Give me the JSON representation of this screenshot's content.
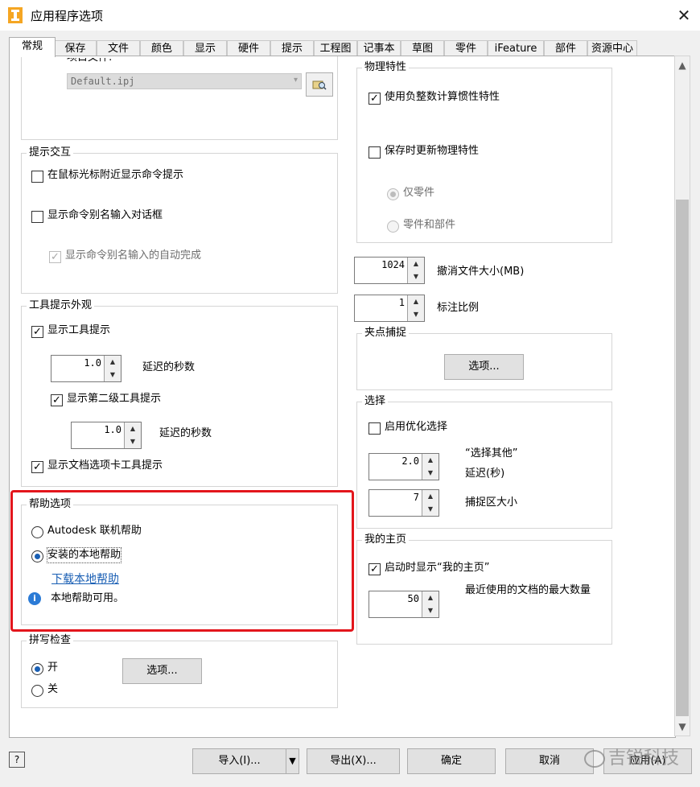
{
  "window": {
    "title": "应用程序选项",
    "close": "✕"
  },
  "tabs": [
    "常规",
    "保存",
    "文件",
    "颜色",
    "显示",
    "硬件",
    "提示",
    "工程图",
    "记事本",
    "草图",
    "零件",
    "iFeature",
    "部件",
    "资源中心"
  ],
  "project": {
    "value": "Default.ipj",
    "partial_label": "项目文件:"
  },
  "prompt_group": {
    "title": "提示交互",
    "show_cmd_near_cursor": "在鼠标光标附近显示命令提示",
    "show_alias_dialog": "显示命令别名输入对话框",
    "alias_autocomplete": "显示命令别名输入的自动完成"
  },
  "tooltip_group": {
    "title": "工具提示外观",
    "show_tooltips": "显示工具提示",
    "delay1": "1.0",
    "delay1_label": "延迟的秒数",
    "show_second": "显示第二级工具提示",
    "delay2": "1.0",
    "delay2_label": "延迟的秒数",
    "show_doc_tab_tips": "显示文档选项卡工具提示"
  },
  "help_group": {
    "title": "帮助选项",
    "online": "Autodesk 联机帮助",
    "local": "安装的本地帮助",
    "download_link": "下载本地帮助",
    "info": "本地帮助可用。"
  },
  "spell_group": {
    "title": "拼写检查",
    "on": "开",
    "off": "关",
    "options": "选项..."
  },
  "physical_group": {
    "title": "物理特性",
    "use_neg_inertia": "使用负整数计算惯性特性",
    "update_on_save": "保存时更新物理特性",
    "parts_only": "仅零件",
    "parts_and_asm": "零件和部件"
  },
  "undo": {
    "value": "1024",
    "label": "撤消文件大小(MB)"
  },
  "annotation": {
    "value": "1",
    "label": "标注比例"
  },
  "grip_group": {
    "title": "夹点捕捉",
    "options": "选项..."
  },
  "select_group": {
    "title": "选择",
    "enable_opt": "启用优化选择",
    "other_value": "2.0",
    "other_label1": "“选择其他”",
    "other_label2": "延迟(秒)",
    "pick_value": "7",
    "pick_label": "捕捉区大小"
  },
  "home_group": {
    "title": "我的主页",
    "show_on_start": "启动时显示“我的主页”",
    "recent_value": "50",
    "recent_label": "最近使用的文档的最大数量"
  },
  "footer": {
    "help": "?",
    "import": "导入(I)...",
    "export": "导出(X)...",
    "ok": "确定",
    "cancel": "取消",
    "apply": "应用(A)",
    "watermark": "吉锐科技"
  }
}
